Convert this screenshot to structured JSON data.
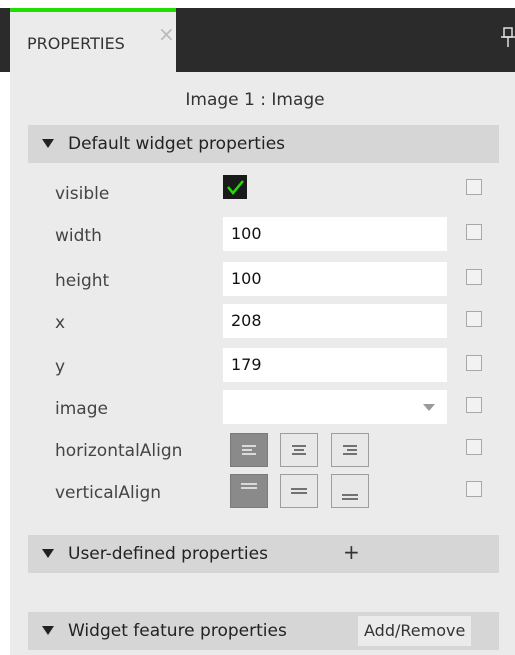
{
  "tab": {
    "label": "PROPERTIES",
    "close_glyph": "×"
  },
  "icons": {
    "pin": "pin-icon",
    "close": "close-icon",
    "check": "checkmark-icon",
    "dropdown": "chevron-down-icon"
  },
  "colors": {
    "tab_accent": "#22dd00",
    "check": "#22dd00",
    "tabbar_bg": "#2b2b2b",
    "panel_bg": "#ebebeb",
    "section_bg": "#d6d6d6"
  },
  "widget": {
    "title": "Image 1 : Image"
  },
  "sections": {
    "default": {
      "label": "Default widget properties"
    },
    "user": {
      "label": "User-defined properties",
      "add_label": "+"
    },
    "feature": {
      "label": "Widget feature properties",
      "action_label": "Add/Remove"
    }
  },
  "properties": {
    "visible": {
      "label": "visible",
      "checked": true
    },
    "width": {
      "label": "width",
      "value": "100"
    },
    "height": {
      "label": "height",
      "value": "100"
    },
    "x": {
      "label": "x",
      "value": "208"
    },
    "y": {
      "label": "y",
      "value": "179"
    },
    "image": {
      "label": "image",
      "value": ""
    },
    "horizontalAlign": {
      "label": "horizontalAlign",
      "options": [
        "left",
        "center",
        "right"
      ],
      "selected": "left"
    },
    "verticalAlign": {
      "label": "verticalAlign",
      "options": [
        "top",
        "middle",
        "bottom"
      ],
      "selected": "top"
    }
  },
  "overrides": {
    "visible": false,
    "width": false,
    "height": false,
    "x": false,
    "y": false,
    "image": false,
    "horizontalAlign": false,
    "verticalAlign": false
  }
}
